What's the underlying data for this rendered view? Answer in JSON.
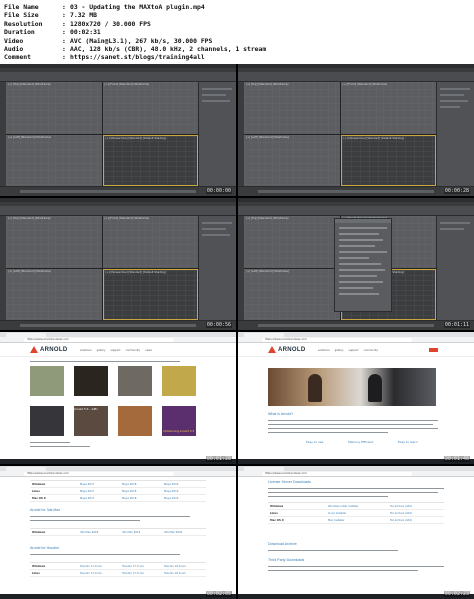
{
  "meta": [
    {
      "key": "File Name",
      "value": "03 - Updating the MAXtoA plugin.mp4"
    },
    {
      "key": "File Size",
      "value": "7.32 MB"
    },
    {
      "key": "Resolution",
      "value": "1280x720 / 30.000 FPS"
    },
    {
      "key": "Duration",
      "value": "00:02:31"
    },
    {
      "key": "Video",
      "value": "AVC (Main@L3.1), 267 kb/s, 30.000 FPS"
    },
    {
      "key": "Audio",
      "value": "AAC, 128 kb/s (CBR), 48.0 kHz, 2 channels, 1 stream"
    },
    {
      "key": "Comment",
      "value": "https://sanet.st/blogs/training4all"
    }
  ],
  "separator": ":",
  "thumbnails": [
    {
      "timestamp": "00:00:00"
    },
    {
      "timestamp": "00:00:28"
    },
    {
      "timestamp": "00:00:56"
    },
    {
      "timestamp": "00:01:11"
    },
    {
      "timestamp": "00:01:28"
    },
    {
      "timestamp": "00:01:46"
    },
    {
      "timestamp": "00:02:05"
    },
    {
      "timestamp": "00:02:23"
    }
  ],
  "max": {
    "viewport_labels": [
      "[+] [Top] [Standard] [Wireframe]",
      "[+] [Front] [Standard] [Wireframe]",
      "[+] [Left] [Standard] [Wireframe]",
      "[+] [Perspective] [Standard] [Default Shading]"
    ]
  },
  "browser": {
    "url": "https://www.arnoldrenderer.com",
    "logo": "ARNOLD",
    "nav": [
      "solutions",
      "gallery",
      "support",
      "community",
      "news",
      "downloads",
      "login",
      "register"
    ],
    "gallery_caption": "Arnold 5.3 – GPU",
    "promo_caption": "Introducing Arnold 5.3",
    "sections": {
      "what_is": "What is Arnold?",
      "memory": "Memory Efficient",
      "easy_use": "Easy to use",
      "easy_learn": "Easy to learn",
      "for_max": "Arnold for 3ds Max",
      "for_houdini": "Arnold for Houdini",
      "license": "License Server Downloads",
      "archive": "Download Archive",
      "third_party": "Third Party Downloads"
    },
    "table_rows_a": [
      {
        "k": "Windows",
        "v1": "Maya 2017",
        "v2": "Maya 2018",
        "v3": "Maya 2019"
      },
      {
        "k": "Linux",
        "v1": "Maya 2017",
        "v2": "Maya 2018",
        "v3": "Maya 2019"
      },
      {
        "k": "Mac OS X",
        "v1": "Maya 2017",
        "v2": "Maya 2018",
        "v3": "Maya 2019"
      }
    ],
    "table_rows_b": [
      {
        "k": "Windows",
        "v1": "3ds Max 2018",
        "v2": "3ds Max 2019",
        "v3": "3ds Max 2020"
      }
    ],
    "table_rows_c": [
      {
        "k": "Windows",
        "v1": "Houdini 17.0.xxx",
        "v2": "Houdini 17.5.xxx",
        "v3": "Houdini 18.0.xxx"
      },
      {
        "k": "Linux",
        "v1": "Houdini 17.0.xxx",
        "v2": "Houdini 17.5.xxx",
        "v3": "Houdini 18.0.xxx"
      }
    ],
    "license_rows": [
      {
        "k": "Windows",
        "v1": "Windows (x64) Installer",
        "v2": "Tar archive (x64)"
      },
      {
        "k": "Linux",
        "v1": "Linux Installer",
        "v2": "Tar archive (x64)"
      },
      {
        "k": "Mac OS X",
        "v1": "Mac Installer",
        "v2": "Tar archive (x64)"
      }
    ]
  },
  "colors": {
    "accent": "#e0442f",
    "link": "#3a7fb5",
    "max_bg": "#444649",
    "viewport_active": "#c9a640"
  }
}
